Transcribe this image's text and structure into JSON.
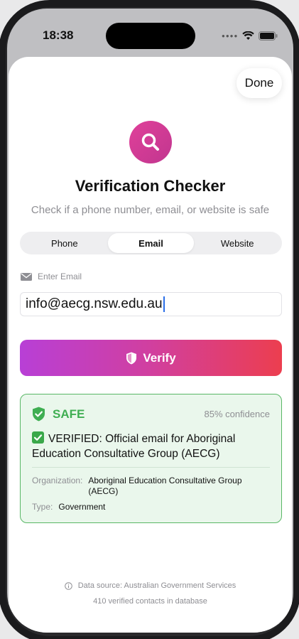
{
  "status_bar": {
    "time": "18:38"
  },
  "header": {
    "done_label": "Done"
  },
  "hero": {
    "title": "Verification Checker",
    "subtitle": "Check if a phone number, email, or website is safe"
  },
  "tabs": [
    {
      "label": "Phone",
      "active": false
    },
    {
      "label": "Email",
      "active": true
    },
    {
      "label": "Website",
      "active": false
    }
  ],
  "form": {
    "field_label": "Enter Email",
    "email_value": "info@aecg.nsw.edu.au",
    "verify_label": "Verify"
  },
  "result": {
    "status": "SAFE",
    "confidence": "85% confidence",
    "message": "VERIFIED: Official email for Aboriginal Education Consultative Group (AECG)",
    "organization_key": "Organization:",
    "organization_value": "Aboriginal Education Consultative Group (AECG)",
    "type_key": "Type:",
    "type_value": "Government"
  },
  "footer": {
    "source": "Data source: Australian Government Services",
    "count": "410 verified contacts in database"
  },
  "colors": {
    "accent_gradient_start": "#b83fd6",
    "accent_gradient_end": "#ec3e4f",
    "safe_green": "#3fae52",
    "card_background": "#eaf7ec"
  },
  "icons": [
    "search-icon",
    "envelope-icon",
    "shield-icon",
    "shield-check-icon",
    "check-emoji-icon",
    "info-icon",
    "wifi-icon",
    "battery-icon",
    "signal-icon"
  ]
}
